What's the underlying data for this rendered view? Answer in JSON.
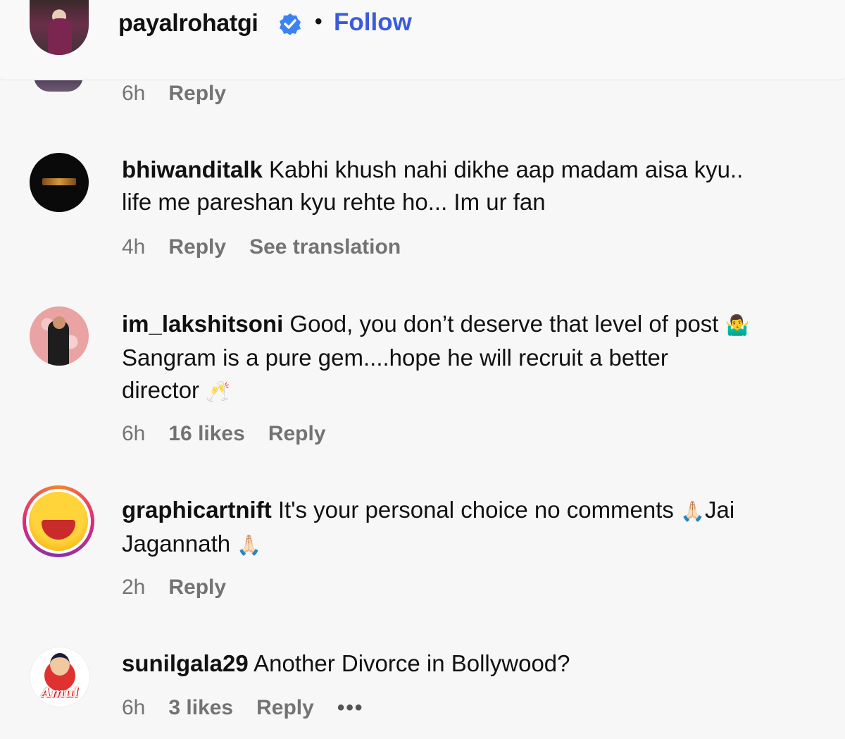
{
  "header": {
    "username": "payalrohatgi",
    "separator": "•",
    "follow_label": "Follow",
    "colors": {
      "follow": "#3b5bdb",
      "verified": "#3b82f6"
    }
  },
  "comments": [
    {
      "meta": {
        "time": "6h",
        "reply": "Reply"
      }
    },
    {
      "username": "bhiwanditalk",
      "text_line1": "Kabhi khush nahi dikhe aap madam aisa kyu..",
      "text_line2": "life me pareshan kyu rehte ho... Im ur fan",
      "meta": {
        "time": "4h",
        "reply": "Reply",
        "translate": "See translation"
      }
    },
    {
      "username": "im_lakshitsoni",
      "text_line1": "Good, you don’t deserve that level of post",
      "emoji1": "🤷‍♂️",
      "text_line2": "Sangram is a pure gem....hope he will recruit a better",
      "text_line3": "director",
      "emoji2": "🥂",
      "meta": {
        "time": "6h",
        "likes": "16 likes",
        "reply": "Reply"
      }
    },
    {
      "username": "graphicartnift",
      "text_line1": "It's your personal choice no comments",
      "emoji1": "🙏🏻",
      "text_line1b": "Jai",
      "text_line2": "Jagannath",
      "emoji2": "🙏🏻",
      "meta": {
        "time": "2h",
        "reply": "Reply"
      }
    },
    {
      "username": "sunilgala29",
      "text_line1": "Another Divorce in Bollywood?",
      "avatar_text": "Amul",
      "meta": {
        "time": "6h",
        "likes": "3 likes",
        "reply": "Reply",
        "more": "•••"
      }
    }
  ]
}
